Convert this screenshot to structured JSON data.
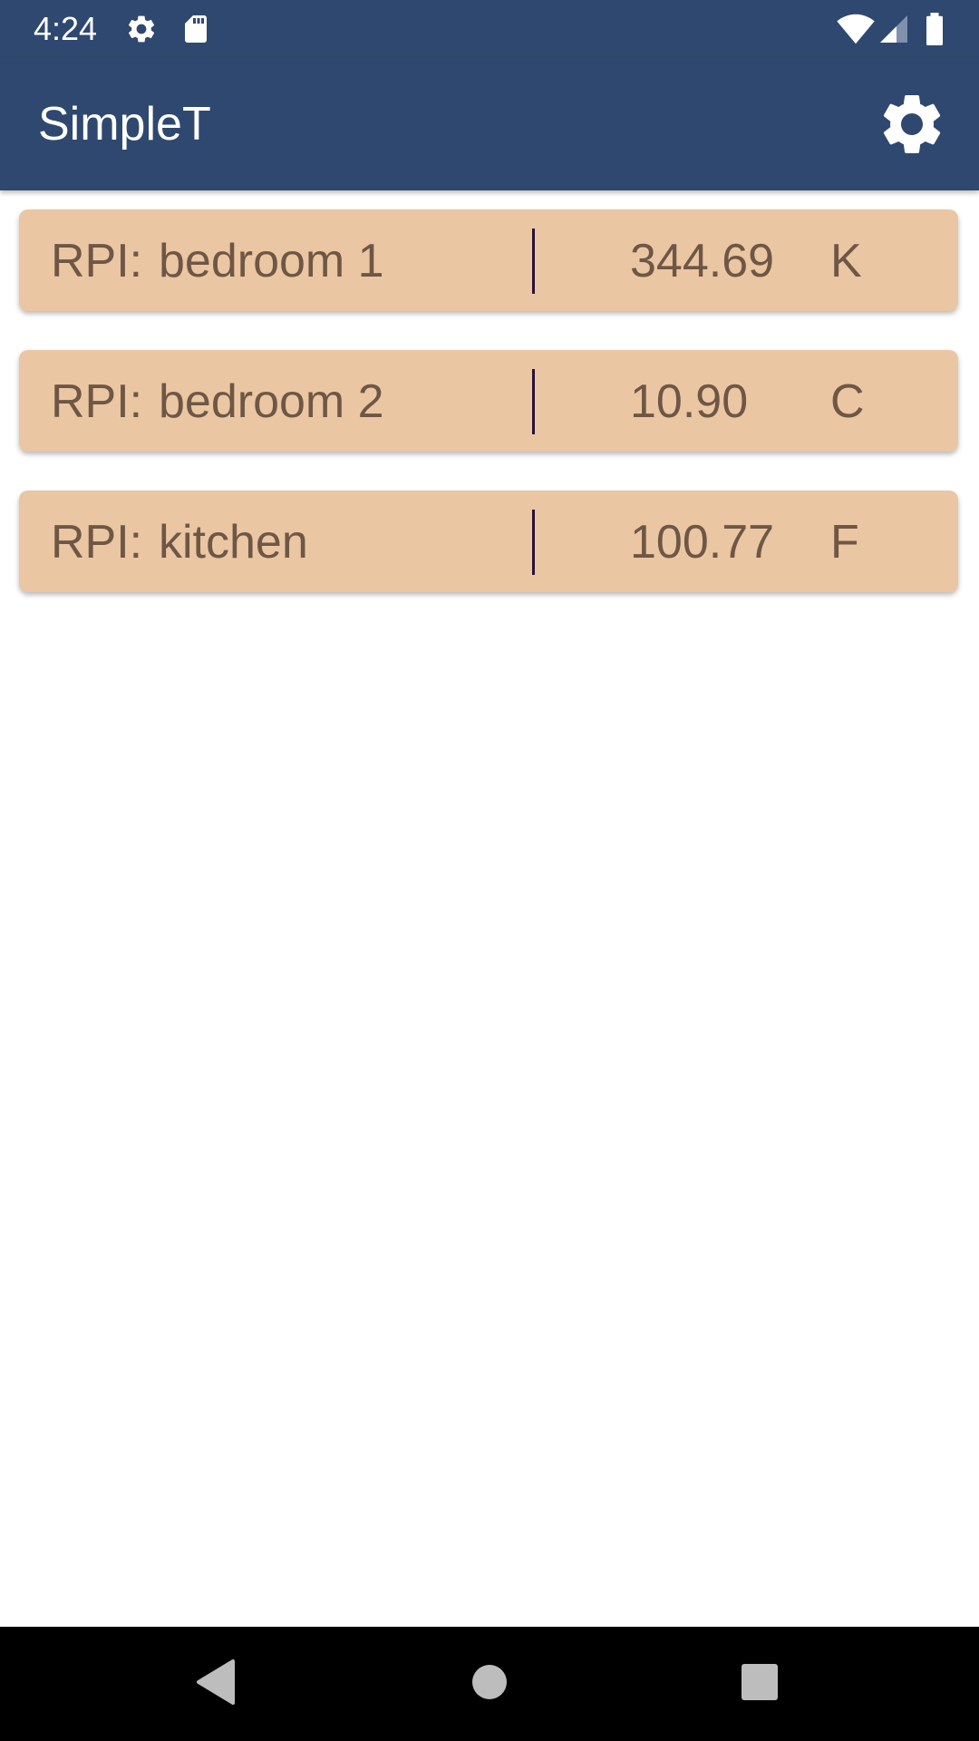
{
  "status_bar": {
    "time": "4:24",
    "icons": [
      "gear-icon",
      "sd-card-icon",
      "wifi-icon",
      "signal-icon",
      "battery-icon"
    ]
  },
  "app_bar": {
    "title": "SimpleT",
    "settings_icon": "gear-icon"
  },
  "sensors": [
    {
      "prefix": "RPI:",
      "name": "bedroom 1",
      "value": "344.69",
      "unit": "K"
    },
    {
      "prefix": "RPI:",
      "name": "bedroom 2",
      "value": "10.90",
      "unit": "C"
    },
    {
      "prefix": "RPI:",
      "name": "kitchen",
      "value": "100.77",
      "unit": "F"
    }
  ],
  "navigation": {
    "buttons": [
      "back-icon",
      "home-icon",
      "recents-icon"
    ]
  },
  "colors": {
    "app_bar": "#2f486f",
    "card": "#ebc6a3",
    "card_text": "#6e5746",
    "divider": "#2a1238"
  }
}
